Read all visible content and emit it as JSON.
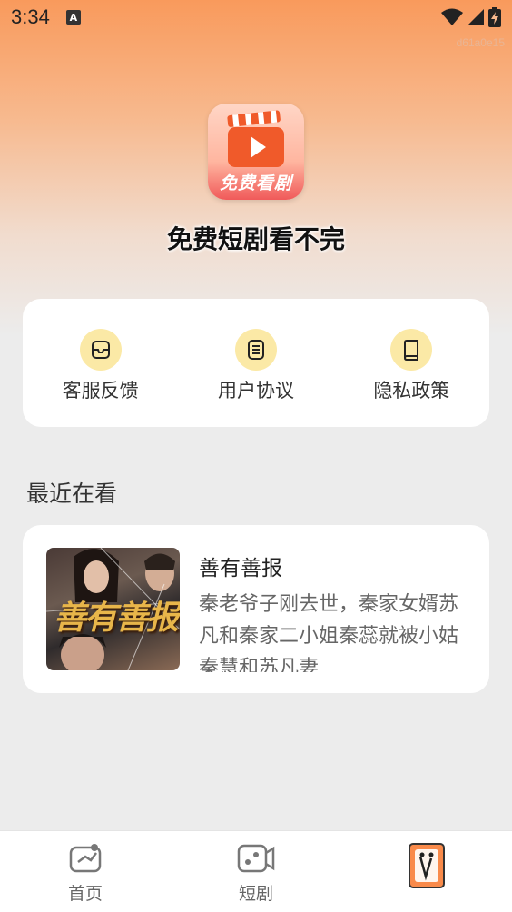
{
  "status_bar": {
    "time": "3:34",
    "notification_icon": "A",
    "icons": [
      "wifi-icon",
      "signal-icon",
      "battery-charging-icon"
    ]
  },
  "build_tag": "d61a0e15",
  "logo": {
    "text": "免费看剧",
    "icon": "video-play-icon"
  },
  "slogan": "免费短剧看不完",
  "menu": {
    "items": [
      {
        "label": "客服反馈",
        "icon": "inbox-icon"
      },
      {
        "label": "用户协议",
        "icon": "document-icon"
      },
      {
        "label": "隐私政策",
        "icon": "book-icon"
      }
    ]
  },
  "recent": {
    "title": "最近在看",
    "items": [
      {
        "title": "善有善报",
        "poster_text": "善有善报",
        "description": "秦老爷子刚去世，秦家女婿苏凡和秦家二小姐秦蕊就被小姑秦慧和苏凡妻"
      }
    ]
  },
  "bottom_nav": {
    "items": [
      {
        "label": "首页",
        "icon": "home-icon"
      },
      {
        "label": "短剧",
        "icon": "short-drama-icon"
      },
      {
        "label": "",
        "icon": "profile-icon"
      }
    ]
  },
  "colors": {
    "accent_orange": "#f99a5c",
    "icon_bg_yellow": "#fbe9a6",
    "card_bg": "#ffffff",
    "page_bg": "#ececec"
  }
}
